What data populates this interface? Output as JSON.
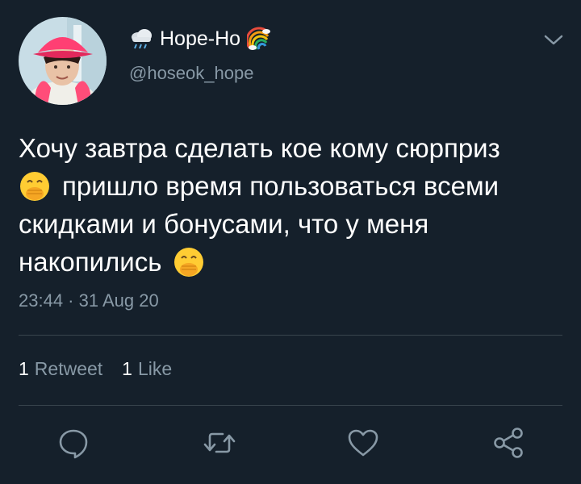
{
  "user": {
    "display_name": "Hope-Ho",
    "handle": "@hoseok_hope",
    "name_prefix_emoji": "cloud-with-rain-icon",
    "name_suffix_emoji": "rainbow-icon"
  },
  "tweet": {
    "lines": [
      "Хочу завтра сделать кое кому сюрприз",
      "пришло время пользоваться всеми",
      "скидками и бонусами, что у меня",
      "накопились"
    ],
    "emoji": "hand-over-mouth-face-icon",
    "timestamp": "23:44 · 31 Aug 20"
  },
  "stats": {
    "retweets_count": "1",
    "retweets_label": "Retweet",
    "likes_count": "1",
    "likes_label": "Like"
  },
  "actions": [
    "reply-icon",
    "retweet-icon",
    "like-icon",
    "share-icon"
  ],
  "colors": {
    "background": "#15202b",
    "text": "#ffffff",
    "secondary_text": "#8899a6",
    "divider": "#38444d",
    "icon": "#8899a6"
  }
}
